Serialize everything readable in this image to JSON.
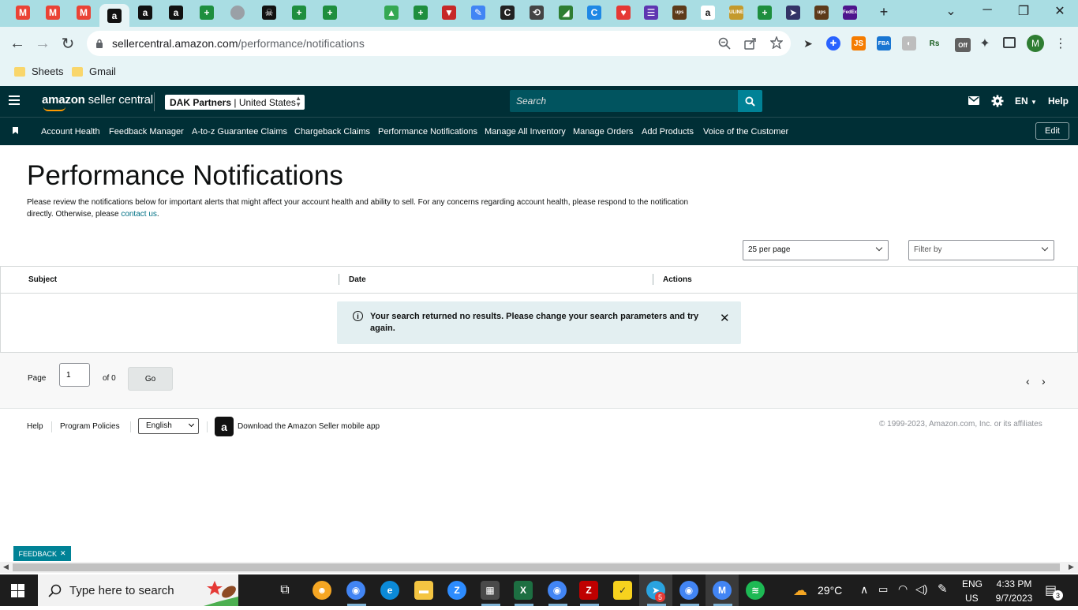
{
  "browser": {
    "tabs": [
      {
        "icon": "gmail-icon",
        "letter": "M",
        "color": "#ea4335"
      },
      {
        "icon": "gmail-icon",
        "letter": "M",
        "color": "#ea4335"
      },
      {
        "icon": "gmail-icon",
        "letter": "M",
        "color": "#ea4335"
      },
      {
        "icon": "amazon-icon",
        "letter": "a",
        "color": "#111111"
      },
      {
        "icon": "amazon-icon",
        "letter": "a",
        "color": "#111111"
      },
      {
        "icon": "amazon-icon",
        "letter": "a",
        "color": "#111111"
      },
      {
        "icon": "sheets-plus-icon",
        "letter": "+",
        "color": "#1e8e3e"
      },
      {
        "icon": "gray-circle-icon",
        "letter": "",
        "color": "#9aa0a6"
      },
      {
        "icon": "pirate-icon",
        "letter": "☠",
        "color": "#111111"
      },
      {
        "icon": "sheets-plus-icon",
        "letter": "+",
        "color": "#1e8e3e"
      },
      {
        "icon": "sheets-plus-icon",
        "letter": "+",
        "color": "#1e8e3e"
      },
      {
        "icon": "blank-icon",
        "letter": "",
        "color": "#a9dde3"
      },
      {
        "icon": "drive-icon",
        "letter": "▲",
        "color": "#34a853"
      },
      {
        "icon": "sheets-plus-icon",
        "letter": "+",
        "color": "#1e8e3e"
      },
      {
        "icon": "shield-red-icon",
        "letter": "▼",
        "color": "#c62828"
      },
      {
        "icon": "pencil-icon",
        "letter": "✎",
        "color": "#4285f4"
      },
      {
        "icon": "c-dark-icon",
        "letter": "C",
        "color": "#222222"
      },
      {
        "icon": "history-icon",
        "letter": "⟲",
        "color": "#444444"
      },
      {
        "icon": "leaf-icon",
        "letter": "◢",
        "color": "#2e7d32"
      },
      {
        "icon": "c-blue-icon",
        "letter": "C",
        "color": "#1e88e5"
      },
      {
        "icon": "heart-icon",
        "letter": "♥",
        "color": "#e53935"
      },
      {
        "icon": "list-icon",
        "letter": "☰",
        "color": "#5e35b1"
      },
      {
        "icon": "ups-icon",
        "letter": "ups",
        "color": "#5d3a1a"
      },
      {
        "icon": "amazon-icon",
        "letter": "a",
        "color": "#ffffff"
      },
      {
        "icon": "uline-icon",
        "letter": "ULINE",
        "color": "#c49a2c"
      },
      {
        "icon": "sheets-plus-icon",
        "letter": "+",
        "color": "#1e8e3e"
      },
      {
        "icon": "usps-icon",
        "letter": "➤",
        "color": "#333366"
      },
      {
        "icon": "ups-icon",
        "letter": "ups",
        "color": "#5d3a1a"
      },
      {
        "icon": "fedex-icon",
        "letter": "FedEx",
        "color": "#4d148c"
      }
    ],
    "new_tab_label": "+",
    "url_host": "sellercentral.amazon.com",
    "url_path": "/performance/notifications",
    "bookmarks": [
      "Sheets",
      "Gmail"
    ],
    "profile_initial": "M",
    "extensions_off_badge": "Off"
  },
  "header": {
    "logo_bold": "amazon",
    "logo_rest": " seller central",
    "account_name": "DAK Partners",
    "account_region": "United States",
    "search_placeholder": "Search",
    "lang": "EN",
    "help": "Help"
  },
  "nav": {
    "links": [
      "Account Health",
      "Feedback Manager",
      "A-to-z Guarantee Claims",
      "Chargeback Claims",
      "Performance Notifications",
      "Manage All Inventory",
      "Manage Orders",
      "Add Products",
      "Voice of the Customer"
    ],
    "edit": "Edit"
  },
  "main": {
    "title": "Performance Notifications",
    "intro": "Please review the notifications below for important alerts that might affect your account health and ability to sell. For any concerns regarding account health, please respond to the notification directly. Otherwise, please ",
    "contact_link": "contact us",
    "intro_end": ".",
    "per_page": "25 per page",
    "filter_placeholder": "Filter by",
    "columns": [
      "Subject",
      "Date",
      "Actions"
    ],
    "alert": "Your search returned no results. Please change your search parameters and try again.",
    "pager": {
      "page_label": "Page",
      "page_value": "1",
      "of_label": "of 0",
      "go": "Go"
    }
  },
  "footer": {
    "help": "Help",
    "policies": "Program Policies",
    "language": "English",
    "app_text": "Download the Amazon Seller mobile app",
    "copyright": "© 1999-2023, Amazon.com, Inc. or its affiliates"
  },
  "feedback_tab": "FEEDBACK",
  "taskbar": {
    "search_placeholder": "Type here to search",
    "weather": "29°C",
    "lang_top": "ENG",
    "lang_bottom": "US",
    "time": "4:33 PM",
    "date": "9/7/2023",
    "notification_count": "3",
    "telegram_badge": "5"
  },
  "colors": {
    "header_bg": "#002f36",
    "accent_teal": "#008296",
    "link": "#007185",
    "alert_bg": "#e3eff1"
  }
}
